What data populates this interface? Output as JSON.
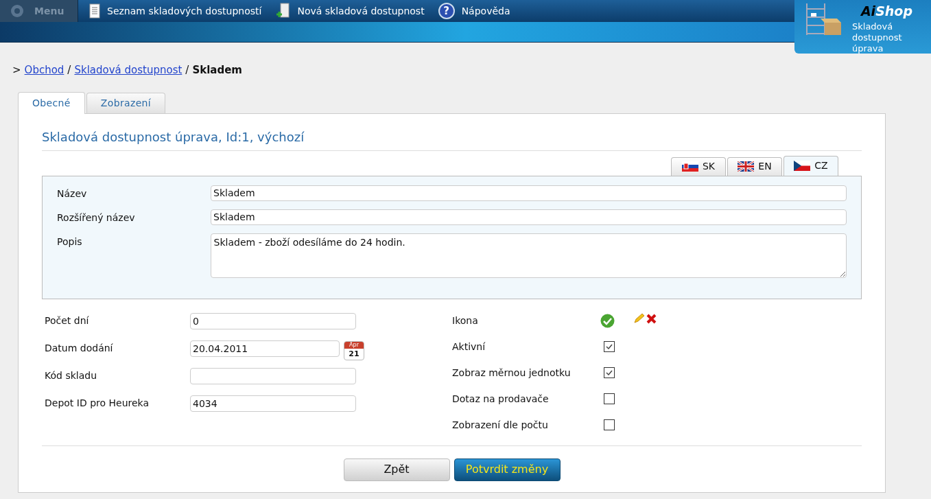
{
  "menu": {
    "label": "Menu"
  },
  "nav_items": [
    {
      "kind": "list",
      "label": "Seznam skladových dostupností"
    },
    {
      "kind": "new",
      "label": "Nová skladová dostupnost"
    },
    {
      "kind": "help",
      "label": "Nápověda",
      "icon_glyph": "?"
    }
  ],
  "badge": {
    "brand_a": "Ai",
    "brand_b": "Shop",
    "caption": "Skladová dostupnost úprava"
  },
  "breadcrumb": [
    {
      "kind": "separator",
      "text": ">"
    },
    {
      "kind": "link",
      "text": "Obchod"
    },
    {
      "kind": "separator",
      "text": "/"
    },
    {
      "kind": "link",
      "text": "Skladová dostupnost"
    },
    {
      "kind": "separator",
      "text": "/"
    },
    {
      "kind": "current",
      "text": "Skladem"
    }
  ],
  "tabs": [
    {
      "label": "Obecné",
      "selected": true
    },
    {
      "label": "Zobrazení",
      "selected": false
    }
  ],
  "heading": "Skladová dostupnost úprava, Id:1, výchozí",
  "language_tabs": [
    {
      "code": "SK",
      "kind": "sk",
      "selected": false
    },
    {
      "code": "EN",
      "kind": "gb",
      "selected": false
    },
    {
      "code": "CZ",
      "kind": "cz",
      "selected": true
    }
  ],
  "localized_fields": [
    {
      "label": "Název",
      "value": "Skladem",
      "kind": "input"
    },
    {
      "label": "Rozšířený název",
      "value": "Skladem",
      "kind": "input"
    },
    {
      "label": "Popis",
      "value": "Skladem - zboží odesíláme do 24 hodin.",
      "kind": "textarea"
    }
  ],
  "left_fields": [
    {
      "label": "Počet dní",
      "value": "0",
      "kind": "text"
    },
    {
      "label": "Datum dodání",
      "value": "20.04.2011",
      "kind": "date",
      "calendar_month": "Apr",
      "calendar_day": "21"
    },
    {
      "label": "Kód skladu",
      "kind": "text"
    },
    {
      "label": "Depot ID pro Heureka",
      "value": "4034",
      "kind": "text"
    }
  ],
  "right_fields": [
    {
      "label": "Ikona",
      "kind": "icon"
    },
    {
      "label": "Aktivní",
      "kind": "checkbox",
      "checked": true
    },
    {
      "label": "Zobraz měrnou jednotku",
      "kind": "checkbox",
      "checked": true
    },
    {
      "label": "Dotaz na prodavače",
      "kind": "checkbox",
      "checked": false
    },
    {
      "label": "Zobrazení dle počtu",
      "kind": "checkbox",
      "checked": false
    }
  ],
  "buttons": [
    {
      "label": "Zpět",
      "kind": "secondary"
    },
    {
      "label": "Potvrdit změny",
      "kind": "primary"
    }
  ]
}
